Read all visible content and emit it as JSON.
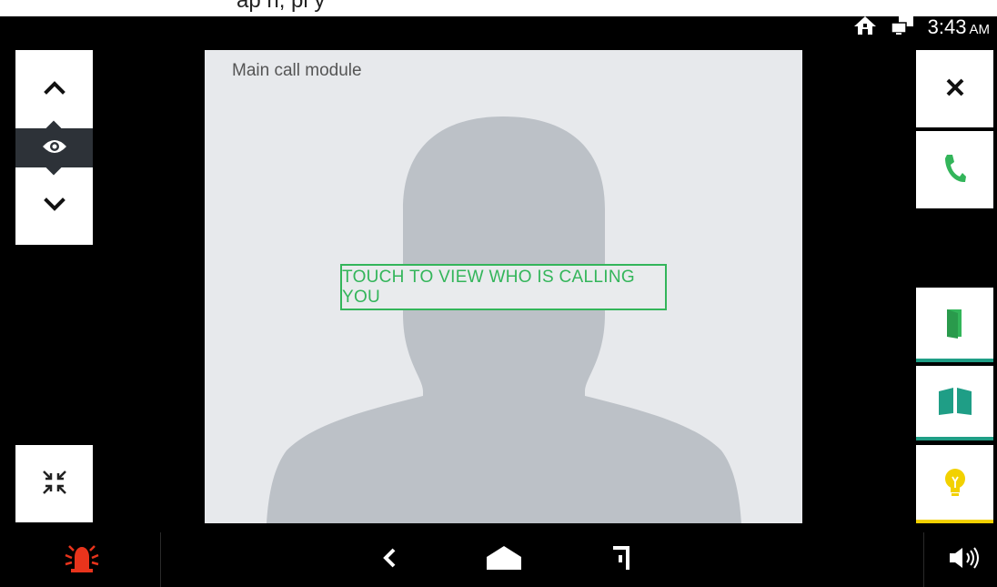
{
  "top_strip": {
    "text": "ap                    n,                           pl     y"
  },
  "status_bar": {
    "icons": [
      "home-icon",
      "network-icon"
    ],
    "time": "3:43",
    "meridiem": "AM"
  },
  "camera_nav": {
    "icons": [
      "chevron-up-icon",
      "eye-icon",
      "chevron-down-icon"
    ]
  },
  "video": {
    "title": "Main call module",
    "touch_prompt": "TOUCH TO VIEW WHO IS CALLING YOU"
  },
  "right_actions": {
    "icons": [
      "close-icon",
      "phone-icon",
      "door-icon",
      "gate-icon",
      "lightbulb-icon"
    ],
    "colors": {
      "phone": "#33b55a",
      "door": "#33b55a",
      "gate": "#1f9e86",
      "light": "#f2d100",
      "accent_line": "#1f9e86"
    }
  },
  "bottom_bar": {
    "icons": [
      "alarm-icon",
      "back-icon",
      "home-nav-icon",
      "recents-icon",
      "volume-icon"
    ],
    "alarm_color": "#e8341c"
  }
}
